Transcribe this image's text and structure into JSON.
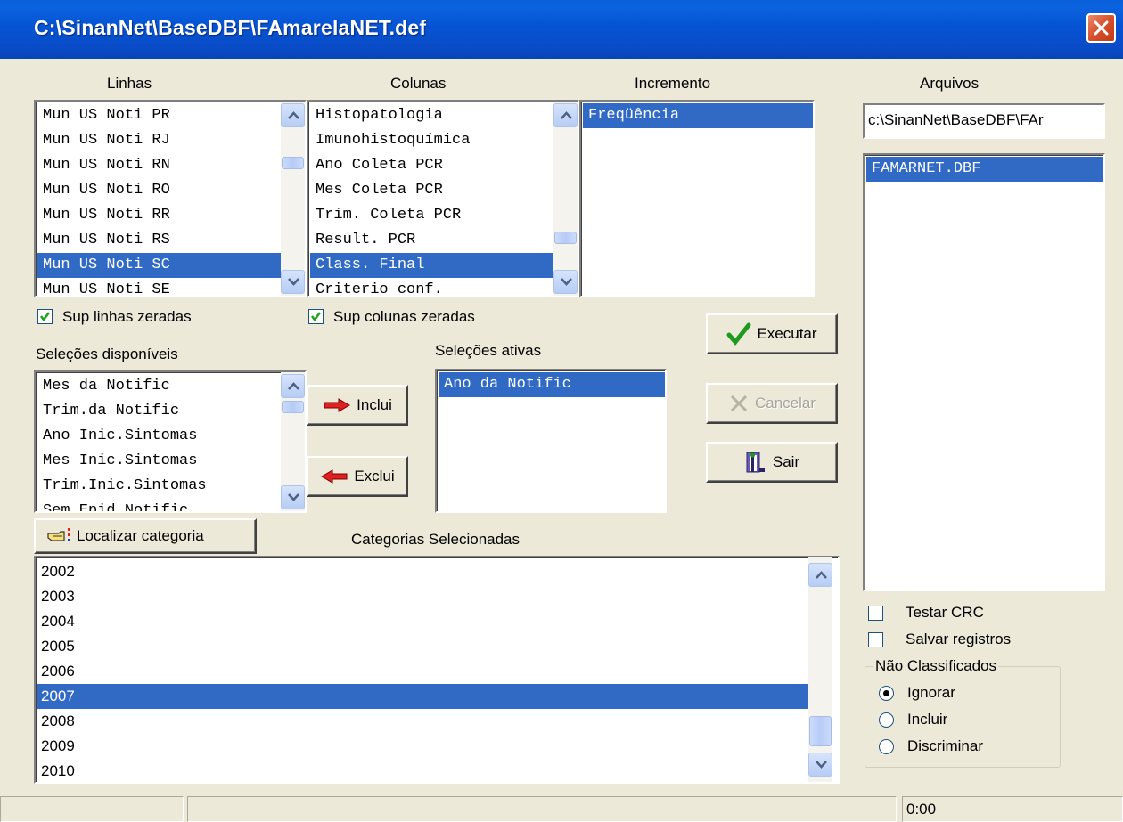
{
  "window": {
    "title": "C:\\SinanNet\\BaseDBF\\FAmarelaNET.def"
  },
  "labels": {
    "linhas": "Linhas",
    "colunas": "Colunas",
    "incremento": "Incremento",
    "arquivos": "Arquivos",
    "selecoes_disponiveis": "Seleções disponíveis",
    "selecoes_ativas": "Seleções ativas",
    "categorias_selecionadas": "Categorias Selecionadas"
  },
  "linhas": {
    "items": [
      "Mun US Noti PR",
      "Mun US Noti RJ",
      "Mun US Noti RN",
      "Mun US Noti RO",
      "Mun US Noti RR",
      "Mun US Noti RS",
      "Mun US Noti SC",
      "Mun US Noti SE"
    ],
    "selected": "Mun US Noti SC"
  },
  "colunas": {
    "items": [
      "Histopatologia",
      "Imunohistoquímica",
      "Ano Coleta PCR",
      "Mes Coleta PCR",
      "Trim. Coleta PCR",
      "Result. PCR",
      "Class. Final",
      "Criterio conf."
    ],
    "selected": "Class. Final"
  },
  "incremento": {
    "items": [
      "Freqüência"
    ],
    "selected": "Freqüência"
  },
  "arquivos": {
    "path": "c:\\SinanNet\\BaseDBF\\FAr",
    "files": [
      "FAMARNET.DBF"
    ],
    "selected": "FAMARNET.DBF"
  },
  "checks": {
    "sup_linhas": {
      "label": "Sup linhas zeradas",
      "checked": true
    },
    "sup_colunas": {
      "label": "Sup colunas zeradas",
      "checked": true
    },
    "testar_crc": {
      "label": "Testar CRC",
      "checked": false
    },
    "salvar_registros": {
      "label": "Salvar registros",
      "checked": false
    }
  },
  "selecoes_disponiveis": {
    "items": [
      "Mes da Notific",
      "Trim.da Notific",
      "Ano Inic.Sintomas",
      "Mes Inic.Sintomas",
      "Trim.Inic.Sintomas",
      "Sem.Epid.Notific"
    ]
  },
  "selecoes_ativas": {
    "items": [
      "Ano da Notific"
    ],
    "selected": "Ano da Notific"
  },
  "buttons": {
    "inclui": "Inclui",
    "exclui": "Exclui",
    "executar": "Executar",
    "cancelar": "Cancelar",
    "sair": "Sair",
    "localizar": "Localizar categoria"
  },
  "categorias": {
    "items": [
      "2002",
      "2003",
      "2004",
      "2005",
      "2006",
      "2007",
      "2008",
      "2009",
      "2010"
    ],
    "selected": "2007"
  },
  "nao_classificados": {
    "legend": "Não Classificados",
    "options": [
      "Ignorar",
      "Incluir",
      "Discriminar"
    ],
    "selected": "Ignorar"
  },
  "statusbar": {
    "panel1": "",
    "panel2": "",
    "time": "0:00"
  },
  "colors": {
    "selection": "#316ac5",
    "titlebar": "#0553d2",
    "face": "#ece9d8"
  }
}
